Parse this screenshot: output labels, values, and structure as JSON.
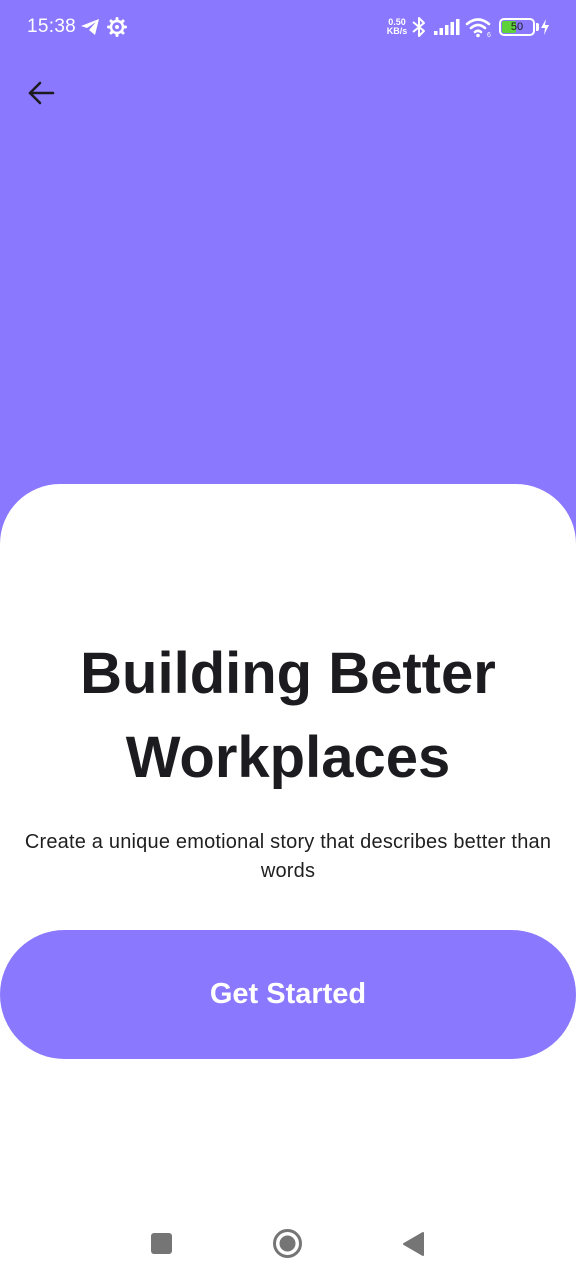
{
  "status_bar": {
    "time": "15:38",
    "net_speed_value": "0.50",
    "net_speed_unit": "KB/s",
    "battery_level": "50",
    "battery_percent": 0.5,
    "icons": [
      "telegram-icon",
      "settings-gear-icon",
      "bluetooth-icon",
      "signal-icon",
      "wifi-icon",
      "battery-icon",
      "charging-bolt-icon"
    ]
  },
  "header": {
    "back_icon": "arrow-left-icon"
  },
  "main": {
    "title": "Building Better Workplaces",
    "subtitle": "Create a unique emotional story that describes better than words",
    "cta_label": "Get Started"
  },
  "nav_bar": {
    "icons": [
      "recents-square-icon",
      "home-circle-icon",
      "back-triangle-icon"
    ]
  },
  "colors": {
    "accent": "#8a78fe",
    "background": "#ffffff",
    "title_text": "#1c1b1f",
    "body_text": "#1f1f1f",
    "battery_fill": "#5ed13b",
    "nav_icon": "#757575"
  }
}
